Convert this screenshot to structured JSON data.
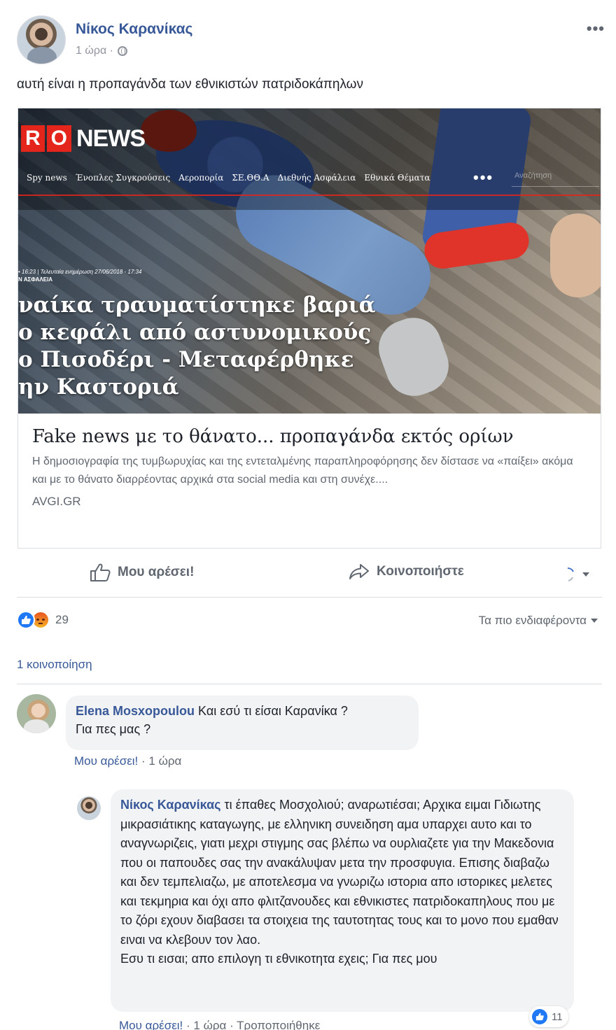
{
  "post": {
    "author": "Νίκος Καρανίκας",
    "time": "1 ώρα ·",
    "privacy_icon": "globe-icon",
    "more_icon": "•••",
    "text": "αυτή είναι η προπαγάνδα των εθνικιστών πατριδοκάπηλων"
  },
  "link_preview": {
    "image": {
      "logo_letters": [
        "R",
        "O"
      ],
      "logo_word": "NEWS",
      "nav": [
        "Spy news",
        "Ένοπλες Συγκρούσεις",
        "Αεροπορία",
        "ΣΕ.ΘΘ.Α",
        "Διεθνής Ασφάλεια",
        "Εθνικά Θέματα"
      ],
      "nav_dots": "•••",
      "search_placeholder": "Αναζήτηση",
      "meta": "• 16:23 | Τελευταία ενημέρωση 27/06/2018 - 17:34",
      "tag": "Ν ΑΣΦΑΛΕΙΑ",
      "headline": "ναίκα τραυματίστηκε βαριά\nο κεφάλι από αστυνομικούς\nο Πισοδέρι - Μεταφέρθηκε\nην Καστοριά"
    },
    "title": "Fake news με το θάνατο... προπαγάνδα εκτός ορίων",
    "description": "Η δημοσιογραφία της τυμβωρυχίας και της εντεταλμένης παραπληροφόρησης δεν δίστασε να «παίξει» ακόμα και με το θάνατο διαρρέοντας αρχικά στα social media και στη συνέχε....",
    "domain": "AVGI.GR"
  },
  "actions": {
    "like": "Μου αρέσει!",
    "share": "Κοινοποιήστε"
  },
  "reactions": {
    "types": [
      "like",
      "angry"
    ],
    "count": "29",
    "sort_label": "Τα πιο ενδιαφέροντα"
  },
  "shares_label": "1 κοινοποίηση",
  "comments": [
    {
      "author": "Elena Mosxopoulou",
      "text": "Και εσύ τι είσαι Καρανίκα ?\nΓια πες μας ?",
      "like_link": "Μου αρέσει!",
      "time": " · 1 ώρα"
    }
  ],
  "reply": {
    "author": "Νίκος Καρανίκας",
    "lead": "τι έπαθες Μοσχολιού; αναρωτιέσαι;",
    "body": "Αρχικα ειμαι Γιδιωτης μικρασιάτικης καταγωγης, με ελληνικη συνειδηση αμα υπαρχει αυτο και το αναγνωριζεις, γιατι μεχρι στιγμης σας βλέπω να ουρλιαζετε για την Μακεδονια που οι παπουδες σας την ανακάλυψαν μετα την προσφυγια. Επισης διαβαζω και δεν τεμπελιαζω, με αποτελεσμα να γνωριζω ιστορια απο ιστορικες μελετες και τεκμηρια και όχι απο φλιτζανουδες και εθνικιστες πατριδοκαπηλους που με το ζόρι εχουν διαβασει τα στοιχεια της ταυτοτητας τους και το μονο που εμαθαν ειναι να κλεβουν τον λαο.",
    "last_line": "Εσυ τι εισαι; απο επιλογη τι εθνικοτητα εχεις; Για πες μου",
    "like_count": "11",
    "like_link": "Μου αρέσει!",
    "time": " · 1 ώρα · ",
    "edited": "Τροποποιήθηκε"
  },
  "colors": {
    "link_blue": "#385898",
    "meta_gray": "#606770",
    "like_blue": "#2078f4",
    "brand_red": "#e3251b"
  }
}
